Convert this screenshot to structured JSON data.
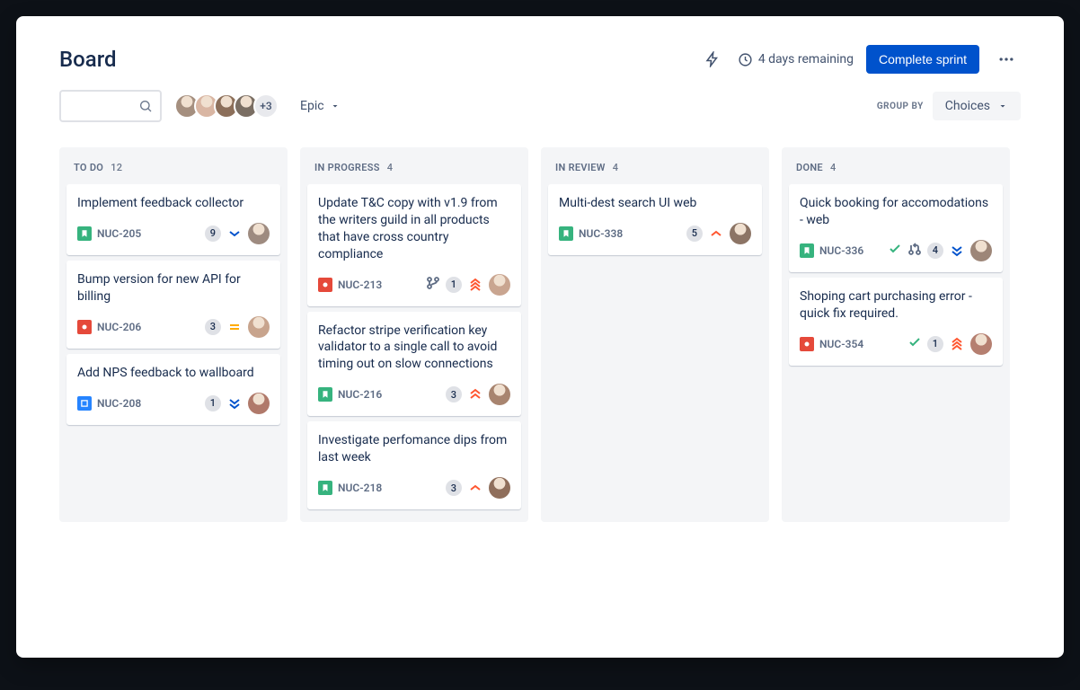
{
  "header": {
    "title": "Board",
    "remaining": "4 days remaining",
    "complete_label": "Complete sprint"
  },
  "toolbar": {
    "avatar_overflow": "+3",
    "epic_label": "Epic",
    "group_by_label": "GROUP BY",
    "choices_label": "Choices"
  },
  "avatar_colors": [
    "#a58f7f",
    "#d9b6a3",
    "#8c6f5a",
    "#7a6e63"
  ],
  "columns": [
    {
      "name": "TO DO",
      "count": "12",
      "cards": [
        {
          "title": "Implement feedback collector",
          "key": "NUC-205",
          "type": "story",
          "badge": "9",
          "priority": "low",
          "assignee": "#9e8b80",
          "extras": []
        },
        {
          "title": "Bump version for new API for billing",
          "key": "NUC-206",
          "type": "bug",
          "badge": "3",
          "priority": "medium",
          "assignee": "#c8a48d",
          "extras": []
        },
        {
          "title": "Add NPS feedback to wallboard",
          "key": "NUC-208",
          "type": "task",
          "badge": "1",
          "priority": "low2",
          "assignee": "#b0796a",
          "extras": []
        }
      ]
    },
    {
      "name": "IN PROGRESS",
      "count": "4",
      "cards": [
        {
          "title": "Update T&C copy with v1.9 from the writers guild in all products that have cross country compliance",
          "key": "NUC-213",
          "type": "bug",
          "badge": "1",
          "priority": "highest",
          "assignee": "#c9a590",
          "extras": [
            "branch"
          ]
        },
        {
          "title": "Refactor stripe verification key validator to a single call to avoid timing out on slow connections",
          "key": "NUC-216",
          "type": "story",
          "badge": "3",
          "priority": "high",
          "assignee": "#a8846f",
          "extras": []
        },
        {
          "title": "Investigate perfomance dips from last week",
          "key": "NUC-218",
          "type": "story",
          "badge": "3",
          "priority": "moderate",
          "assignee": "#8f6e5b",
          "extras": []
        }
      ]
    },
    {
      "name": "IN REVIEW",
      "count": "4",
      "cards": [
        {
          "title": "Multi-dest search UI web",
          "key": "NUC-338",
          "type": "story",
          "badge": "5",
          "priority": "moderate",
          "assignee": "#8c7465",
          "extras": []
        }
      ]
    },
    {
      "name": "DONE",
      "count": "4",
      "cards": [
        {
          "title": "Quick booking for accomodations - web",
          "key": "NUC-336",
          "type": "story",
          "badge": "4",
          "priority": "low2",
          "assignee": "#9d8678",
          "extras": [
            "check",
            "pr"
          ]
        },
        {
          "title": "Shoping cart purchasing error - quick fix required.",
          "key": "NUC-354",
          "type": "bug",
          "badge": "1",
          "priority": "highest",
          "assignee": "#b57f70",
          "extras": [
            "check"
          ]
        }
      ]
    }
  ]
}
